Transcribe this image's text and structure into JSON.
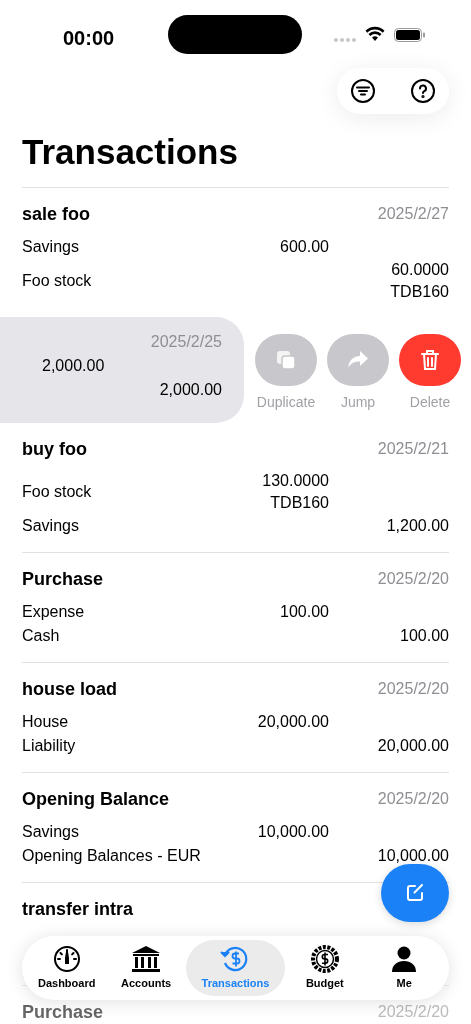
{
  "status_bar": {
    "time": "00:00"
  },
  "toolbar": {
    "buttons": [
      {
        "kind": "filter"
      },
      {
        "kind": "help"
      }
    ]
  },
  "title": "Transactions",
  "transactions": [
    {
      "kind": "normal",
      "title": "sale foo",
      "date": "2025/2/27",
      "lines": [
        {
          "account": "Savings",
          "debit": "600.00"
        },
        {
          "account": "Foo stock",
          "credit": "60.0000",
          "credit_unit": "TDB160"
        }
      ]
    },
    {
      "kind": "swiped",
      "date": "2025/2/25",
      "lines": [
        {
          "debit": "2,000.00"
        },
        {
          "credit": "2,000.00"
        }
      ],
      "actions": [
        {
          "kind": "duplicate",
          "label": "Duplicate"
        },
        {
          "kind": "jump",
          "label": "Jump"
        },
        {
          "kind": "delete",
          "label": "Delete"
        }
      ]
    },
    {
      "kind": "normal",
      "title": "buy foo",
      "date": "2025/2/21",
      "lines": [
        {
          "account": "Foo stock",
          "debit": "130.0000",
          "debit_unit": "TDB160"
        },
        {
          "account": "Savings",
          "credit": "1,200.00"
        }
      ]
    },
    {
      "kind": "normal",
      "title": "Purchase",
      "date": "2025/2/20",
      "lines": [
        {
          "account": "Expense",
          "debit": "100.00"
        },
        {
          "account": "Cash",
          "credit": "100.00"
        }
      ]
    },
    {
      "kind": "normal",
      "title": "house load",
      "date": "2025/2/20",
      "lines": [
        {
          "account": "House",
          "debit": "20,000.00"
        },
        {
          "account": "Liability",
          "credit": "20,000.00"
        }
      ]
    },
    {
      "kind": "normal",
      "title": "Opening Balance",
      "date": "2025/2/20",
      "lines": [
        {
          "account": "Savings",
          "debit": "10,000.00"
        },
        {
          "account": "Opening Balances - EUR",
          "credit": "10,000.00"
        }
      ]
    },
    {
      "kind": "covered",
      "title": "transfer intra"
    },
    {
      "kind": "faded",
      "title": "Purchase",
      "date": "2025/2/20"
    }
  ],
  "tab_bar": [
    {
      "kind": "dashboard",
      "label": "Dashboard",
      "selected": false
    },
    {
      "kind": "accounts",
      "label": "Accounts",
      "selected": false
    },
    {
      "kind": "transactions",
      "label": "Transactions",
      "selected": true
    },
    {
      "kind": "budget",
      "label": "Budget",
      "selected": false
    },
    {
      "kind": "me",
      "label": "Me",
      "selected": false
    }
  ]
}
